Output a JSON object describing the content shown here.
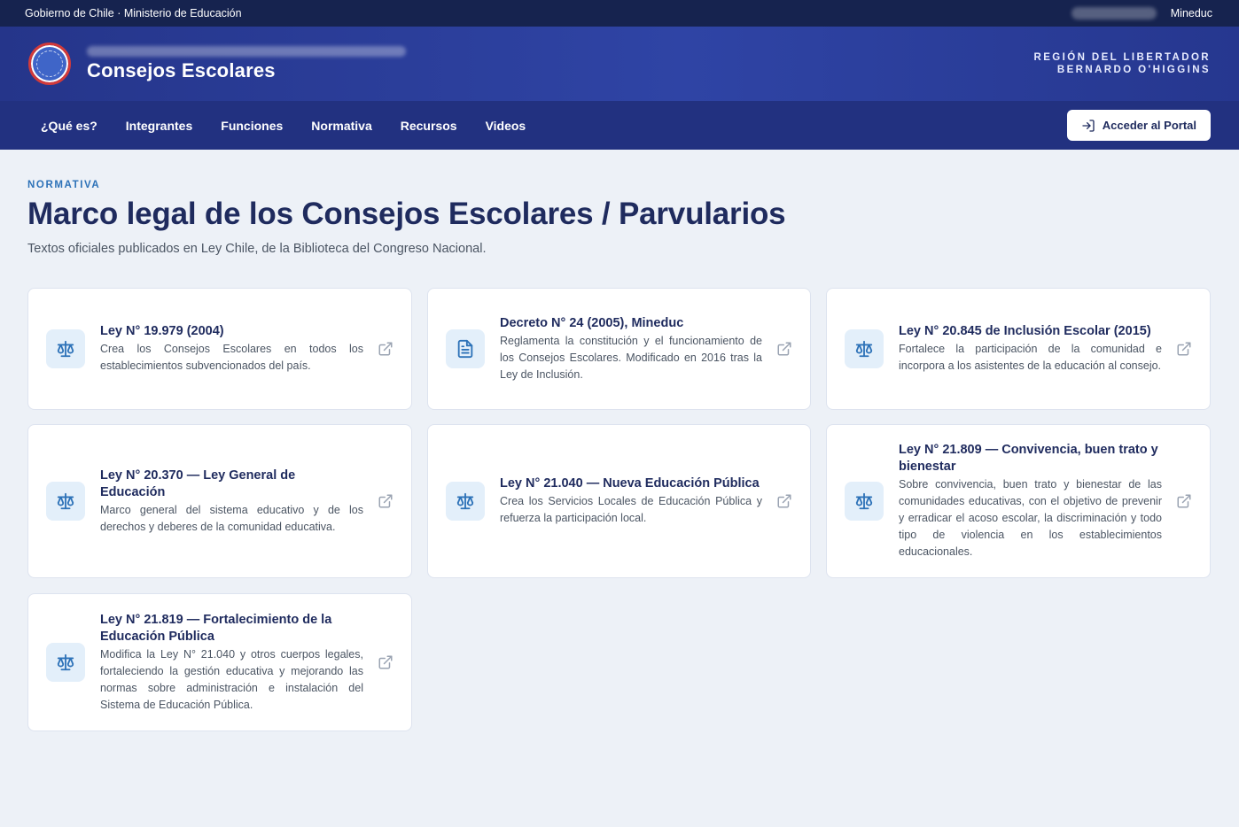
{
  "topbar": {
    "left_text": "Gobierno de Chile · Ministerio de Educación",
    "right_text": "Mineduc"
  },
  "header": {
    "title": "Consejos Escolares",
    "region_line1": "REGIÓN DEL LIBERTADOR",
    "region_line2": "BERNARDO O'HIGGINS"
  },
  "nav": {
    "items": [
      {
        "label": "¿Qué es?"
      },
      {
        "label": "Integrantes"
      },
      {
        "label": "Funciones"
      },
      {
        "label": "Normativa"
      },
      {
        "label": "Recursos"
      },
      {
        "label": "Videos"
      }
    ],
    "portal_button": "Acceder al Portal"
  },
  "main": {
    "eyebrow": "NORMATIVA",
    "title": "Marco legal de los Consejos Escolares / Parvularios",
    "description": "Textos oficiales publicados en Ley Chile, de la Biblioteca del Congreso Nacional."
  },
  "cards": [
    {
      "icon": "scale-icon",
      "title": "Ley N° 19.979 (2004)",
      "text": "Crea los Consejos Escolares en todos los establecimientos subvencionados del país."
    },
    {
      "icon": "document-icon",
      "title": "Decreto N° 24 (2005), Mineduc",
      "text": "Reglamenta la constitución y el funcionamiento de los Consejos Escolares. Modificado en 2016 tras la Ley de Inclusión."
    },
    {
      "icon": "scale-icon",
      "title": "Ley N° 20.845 de Inclusión Escolar (2015)",
      "text": "Fortalece la participación de la comunidad e incorpora a los asistentes de la educación al consejo."
    },
    {
      "icon": "scale-icon",
      "title": "Ley N° 20.370 — Ley General de Educación",
      "text": "Marco general del sistema educativo y de los derechos y deberes de la comunidad educativa."
    },
    {
      "icon": "scale-icon",
      "title": "Ley N° 21.040 — Nueva Educación Pública",
      "text": "Crea los Servicios Locales de Educación Pública y refuerza la participación local."
    },
    {
      "icon": "scale-icon",
      "title": "Ley N° 21.809 — Convivencia, buen trato y bienestar",
      "text": "Sobre convivencia, buen trato y bienestar de las comunidades educativas, con el objetivo de prevenir y erradicar el acoso escolar, la discriminación y todo tipo de violencia en los establecimientos educacionales."
    },
    {
      "icon": "scale-icon",
      "title": "Ley N° 21.819 — Fortalecimiento de la Educación Pública",
      "text": "Modifica la Ley N° 21.040 y otros cuerpos legales, fortaleciendo la gestión educativa y mejorando las normas sobre administración e instalación del Sistema de Educación Pública."
    }
  ]
}
